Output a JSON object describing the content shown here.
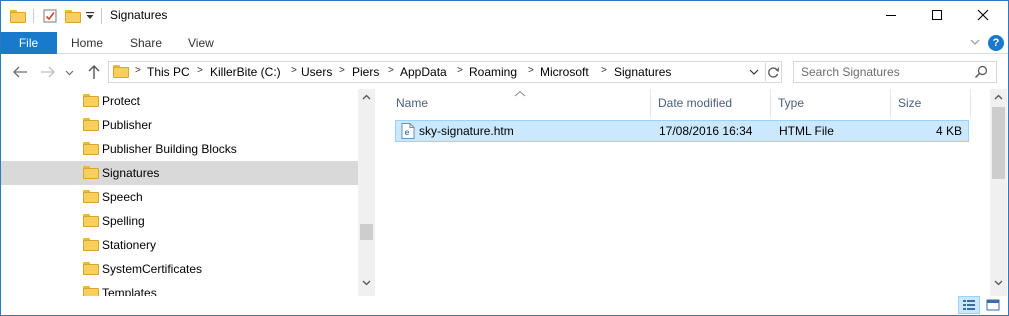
{
  "window": {
    "title": "Signatures",
    "quick_access": [
      "folder-icon",
      "properties-icon",
      "new-folder-icon",
      "customize-dropdown-icon"
    ],
    "controls": [
      "minimize",
      "maximize",
      "close"
    ]
  },
  "ribbon": {
    "tabs": [
      {
        "label": "File"
      },
      {
        "label": "Home"
      },
      {
        "label": "Share"
      },
      {
        "label": "View"
      }
    ],
    "help": "?"
  },
  "address": {
    "crumbs": [
      "This PC",
      "KillerBite (C:)",
      "Users",
      "Piers",
      "AppData",
      "Roaming",
      "Microsoft",
      "Signatures"
    ]
  },
  "search": {
    "placeholder": "Search Signatures"
  },
  "nav_pane": {
    "items": [
      {
        "label": "Protect",
        "selected": false
      },
      {
        "label": "Publisher",
        "selected": false
      },
      {
        "label": "Publisher Building Blocks",
        "selected": false
      },
      {
        "label": "Signatures",
        "selected": true
      },
      {
        "label": "Speech",
        "selected": false
      },
      {
        "label": "Spelling",
        "selected": false
      },
      {
        "label": "Stationery",
        "selected": false
      },
      {
        "label": "SystemCertificates",
        "selected": false
      },
      {
        "label": "Templates",
        "selected": false
      }
    ]
  },
  "content": {
    "columns": [
      "Name",
      "Date modified",
      "Type",
      "Size"
    ],
    "sort_column": "Name",
    "sort_direction": "ascending",
    "rows": [
      {
        "name": "sky-signature.htm",
        "date_modified": "17/08/2016 16:34",
        "type": "HTML File",
        "size": "4 KB",
        "selected": true
      }
    ]
  },
  "view_modes": [
    "details-view-icon",
    "large-icons-view-icon"
  ],
  "colors": {
    "file_tab": "#1979ca",
    "selection": "#cce8ff",
    "selection_border": "#99d1ff",
    "nav_selected": "#d9d9d9",
    "header_text": "#4c607a"
  }
}
